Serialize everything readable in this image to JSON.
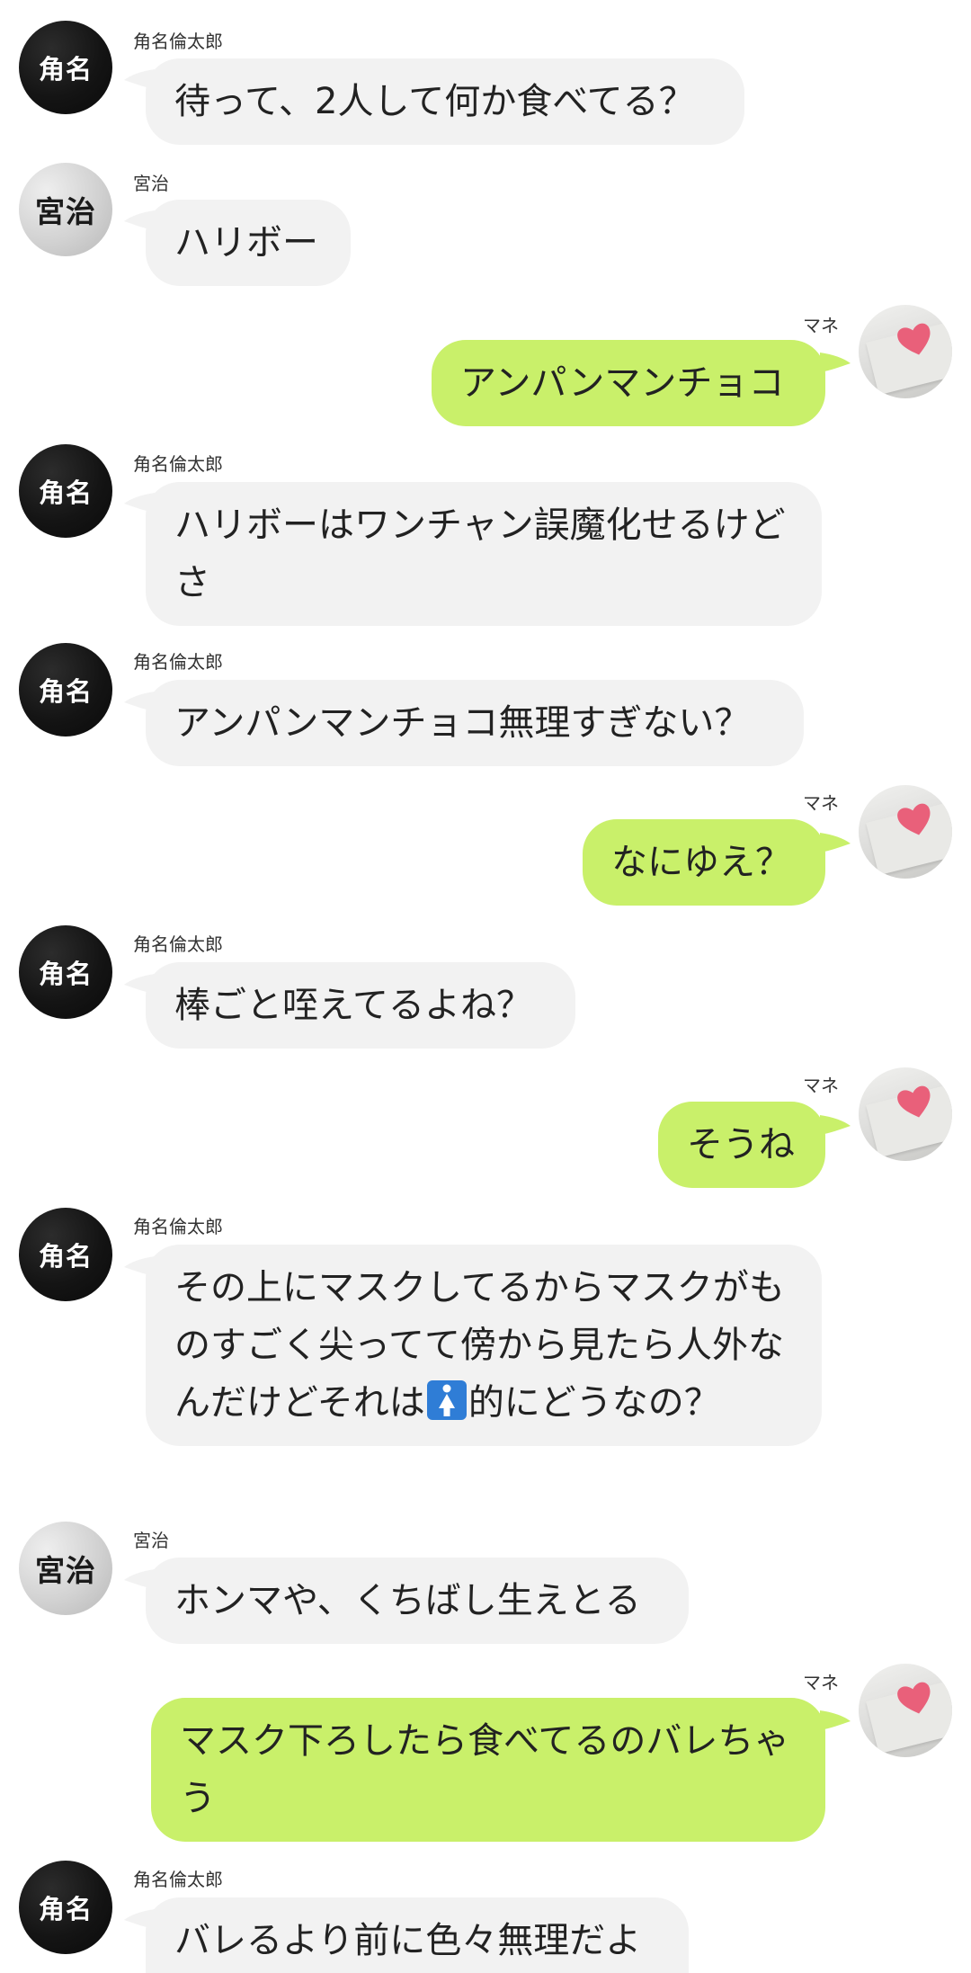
{
  "names": {
    "sunarin": "角名倫太郎",
    "miya": "宮治",
    "mane": "マネ"
  },
  "avatars": {
    "sunarin_label": "角名",
    "miya_label": "宮治",
    "mane_icon": "heart-card-photo-icon"
  },
  "colors": {
    "incoming_bubble": "#f2f2f2",
    "outgoing_bubble": "#c9f06a",
    "background": "#ffffff"
  },
  "messages": [
    {
      "sender": "角名倫太郎",
      "text": "待って、2人して何か食べてる？"
    },
    {
      "sender": "宮治",
      "text": "ハリボー"
    },
    {
      "sender": "マネ",
      "text": "アンパンマンチョコ"
    },
    {
      "sender": "角名倫太郎",
      "text": "ハリボーはワンチャン誤魔化せるけどさ"
    },
    {
      "sender": "角名倫太郎",
      "text": "アンパンマンチョコ無理すぎない？"
    },
    {
      "sender": "マネ",
      "text": "なにゆえ？"
    },
    {
      "sender": "角名倫太郎",
      "text": "棒ごと咥えてるよね？"
    },
    {
      "sender": "マネ",
      "text": "そうね"
    },
    {
      "sender": "角名倫太郎",
      "text_before_emoji": "その上にマスクしてるからマスクがものすごく尖ってて傍から見たら人外なんだけどそれは",
      "emoji": "womens-room-emoji",
      "text_after_emoji": "的にどうなの？"
    },
    {
      "sender": "宮治",
      "text": "ホンマや、くちばし生えとる"
    },
    {
      "sender": "マネ",
      "text": "マスク下ろしたら食べてるのバレちゃう"
    },
    {
      "sender": "角名倫太郎",
      "text": "バレるより前に色々無理だよ"
    }
  ]
}
